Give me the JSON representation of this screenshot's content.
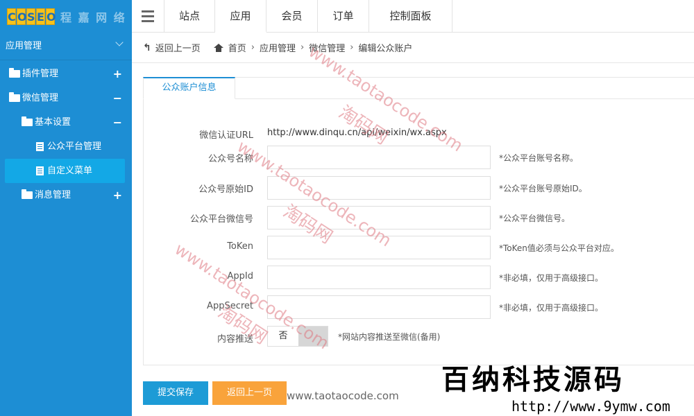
{
  "logo": {
    "badge": "COSEO",
    "text": "程 嘉 网 络"
  },
  "topnav": {
    "items": [
      "站点",
      "应用",
      "会员",
      "订单",
      "控制面板"
    ],
    "active": 1
  },
  "sidebar": {
    "header": "应用管理",
    "items": [
      {
        "label": "插件管理",
        "sign": "+"
      },
      {
        "label": "微信管理",
        "sign": "−"
      },
      {
        "label": "基本设置",
        "sign": "−"
      },
      {
        "label": "公众平台管理"
      },
      {
        "label": "自定义菜单"
      },
      {
        "label": "消息管理",
        "sign": "+"
      }
    ]
  },
  "breadcrumb": {
    "back": "返回上一页",
    "items": [
      "首页",
      "应用管理",
      "微信管理",
      "编辑公众账户"
    ]
  },
  "tab": {
    "label": "公众账户信息"
  },
  "form": {
    "url_label": "微信认证URL",
    "url_value": "http://www.dinqu.cn/api/weixin/wx.aspx",
    "fields": [
      {
        "label": "公众号名称",
        "value": "",
        "hint": "*公众平台账号名称。"
      },
      {
        "label": "公众号原始ID",
        "value": "",
        "hint": "*公众平台账号原始ID。"
      },
      {
        "label": "公众平台微信号",
        "value": "",
        "hint": "*公众平台微信号。"
      },
      {
        "label": "ToKen",
        "value": "",
        "hint": "*ToKen值必须与公众平台对应。"
      },
      {
        "label": "AppId",
        "value": "",
        "hint": "*非必填，仅用于高级接口。"
      },
      {
        "label": "AppSecret",
        "value": "",
        "hint": "*非必填，仅用于高级接口。"
      }
    ],
    "push_label": "内容推送",
    "push_value": "否",
    "push_hint": "*网站内容推送至微信(备用)"
  },
  "buttons": {
    "save": "提交保存",
    "back": "返回上一页"
  },
  "watermark": {
    "url": "www.taotaocode.com",
    "cn": "淘码网",
    "footer_url": "www.taotaocode.com"
  },
  "brand": {
    "title": "百纳科技源码",
    "url": "http://www.9ymw.com"
  },
  "colors": {
    "sidebar": "#1d8ed4",
    "active_item": "#13a8e6",
    "save_btn": "#1d9bd6",
    "back_btn": "#f9a33b"
  }
}
